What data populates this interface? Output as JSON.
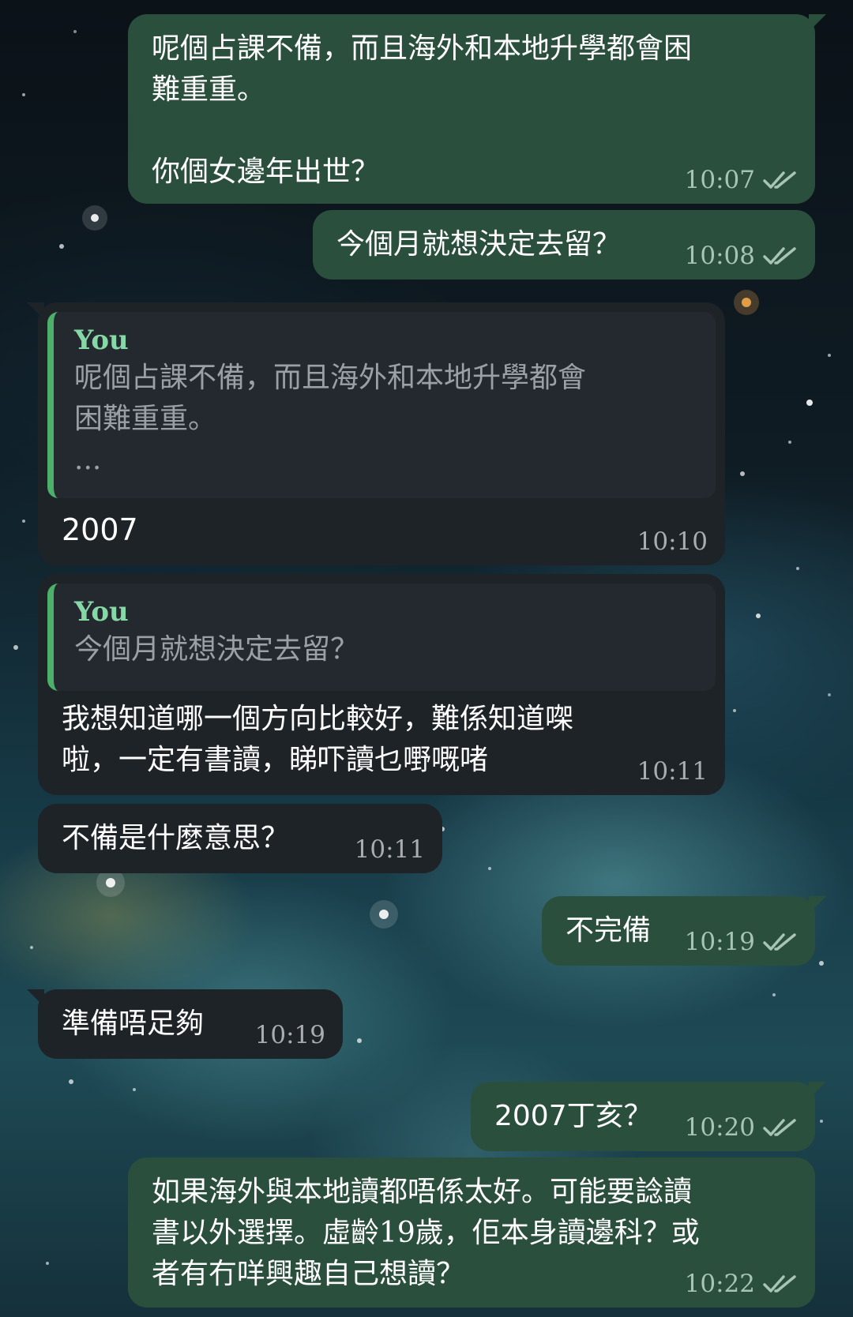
{
  "messages": [
    {
      "id": "m1",
      "direction": "outgoing",
      "text": "呢個占課不備，而且海外和本地升學都會困\n難重重。\n\n你個女邊年出世？",
      "time": "10:07",
      "status": "read"
    },
    {
      "id": "m2",
      "direction": "outgoing",
      "text": "今個月就想決定去留？",
      "time": "10:08",
      "status": "read"
    },
    {
      "id": "m3",
      "direction": "incoming",
      "reply_to": {
        "name": "You",
        "text": "呢個占課不備，而且海外和本地升學都會\n困難重重。\n..."
      },
      "text": "2007",
      "time": "10:10"
    },
    {
      "id": "m4",
      "direction": "incoming",
      "reply_to": {
        "name": "You",
        "text": "今個月就想決定去留？"
      },
      "text": "我想知道哪一個方向比較好，難係知道㗎\n啦，一定有書讀，睇吓讀乜嘢嘅啫",
      "time": "10:11"
    },
    {
      "id": "m5",
      "direction": "incoming",
      "text": "不備是什麼意思？",
      "time": "10:11"
    },
    {
      "id": "m6",
      "direction": "outgoing",
      "text": "不完備",
      "time": "10:19",
      "status": "read"
    },
    {
      "id": "m7",
      "direction": "incoming",
      "text": "準備唔足夠",
      "time": "10:19"
    },
    {
      "id": "m8",
      "direction": "outgoing",
      "text": "2007丁亥？",
      "time": "10:20",
      "status": "read"
    },
    {
      "id": "m9",
      "direction": "outgoing",
      "text": "如果海外與本地讀都唔係太好。可能要諗讀\n書以外選擇。虛齡19歲，佢本身讀邊科？或\n者有冇咩興趣自己想讀？",
      "time": "10:22",
      "status": "read"
    }
  ],
  "colors": {
    "outgoing_bubble": "#2b4f3d",
    "incoming_bubble": "#1e2328",
    "reply_accent": "#4caf6a",
    "reply_name": "#86d9a6"
  },
  "icons": {
    "read_receipt": "double-check-icon"
  }
}
